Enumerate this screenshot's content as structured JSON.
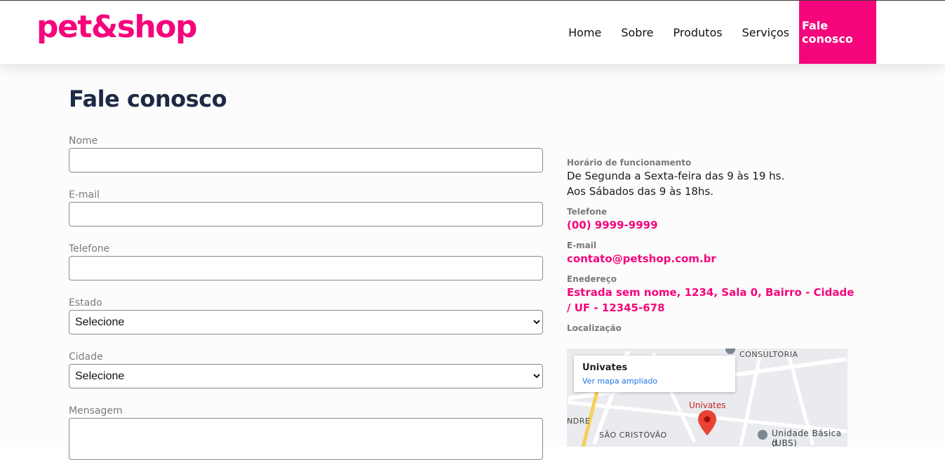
{
  "brand": {
    "logo_text": "pet&shop",
    "accent_color": "#f5047b"
  },
  "nav": {
    "items": [
      "Home",
      "Sobre",
      "Produtos",
      "Serviços",
      "Fale conosco"
    ],
    "active": "Fale conosco"
  },
  "page": {
    "title": "Fale conosco"
  },
  "form": {
    "nome_label": "Nome",
    "nome_value": "",
    "email_label": "E-mail",
    "email_value": "",
    "telefone_label": "Telefone",
    "telefone_value": "",
    "estado_label": "Estado",
    "estado_selected": "Selecione",
    "cidade_label": "Cidade",
    "cidade_selected": "Selecione",
    "mensagem_label": "Mensagem",
    "mensagem_value": ""
  },
  "info": {
    "horario_label": "Horário de funcionamento",
    "horario_line1": "De Segunda a Sexta-feira das 9 às 19 hs.",
    "horario_line2": "Aos Sábados das 9 às 18hs.",
    "telefone_label": "Telefone",
    "telefone_value": "(00) 9999-9999",
    "email_label": "E-mail",
    "email_value": "contato@petshop.com.br",
    "endereco_label": "Enedereço",
    "endereco_value": "Estrada sem nome, 1234, Sala 0, Bairro - Cidade / UF - 12345-678",
    "localizacao_label": "Localização"
  },
  "map": {
    "place_title": "Univates",
    "place_link": "Ver mapa ampliado",
    "marker_label": "Univates",
    "labels": [
      "CONSULTORIA",
      "NDRE",
      "SÃO CRISTÓVÃO",
      "Unidade Básica d",
      "(UBS) Universitár"
    ],
    "icons": [
      "map-pin-icon",
      "place-icon"
    ]
  }
}
